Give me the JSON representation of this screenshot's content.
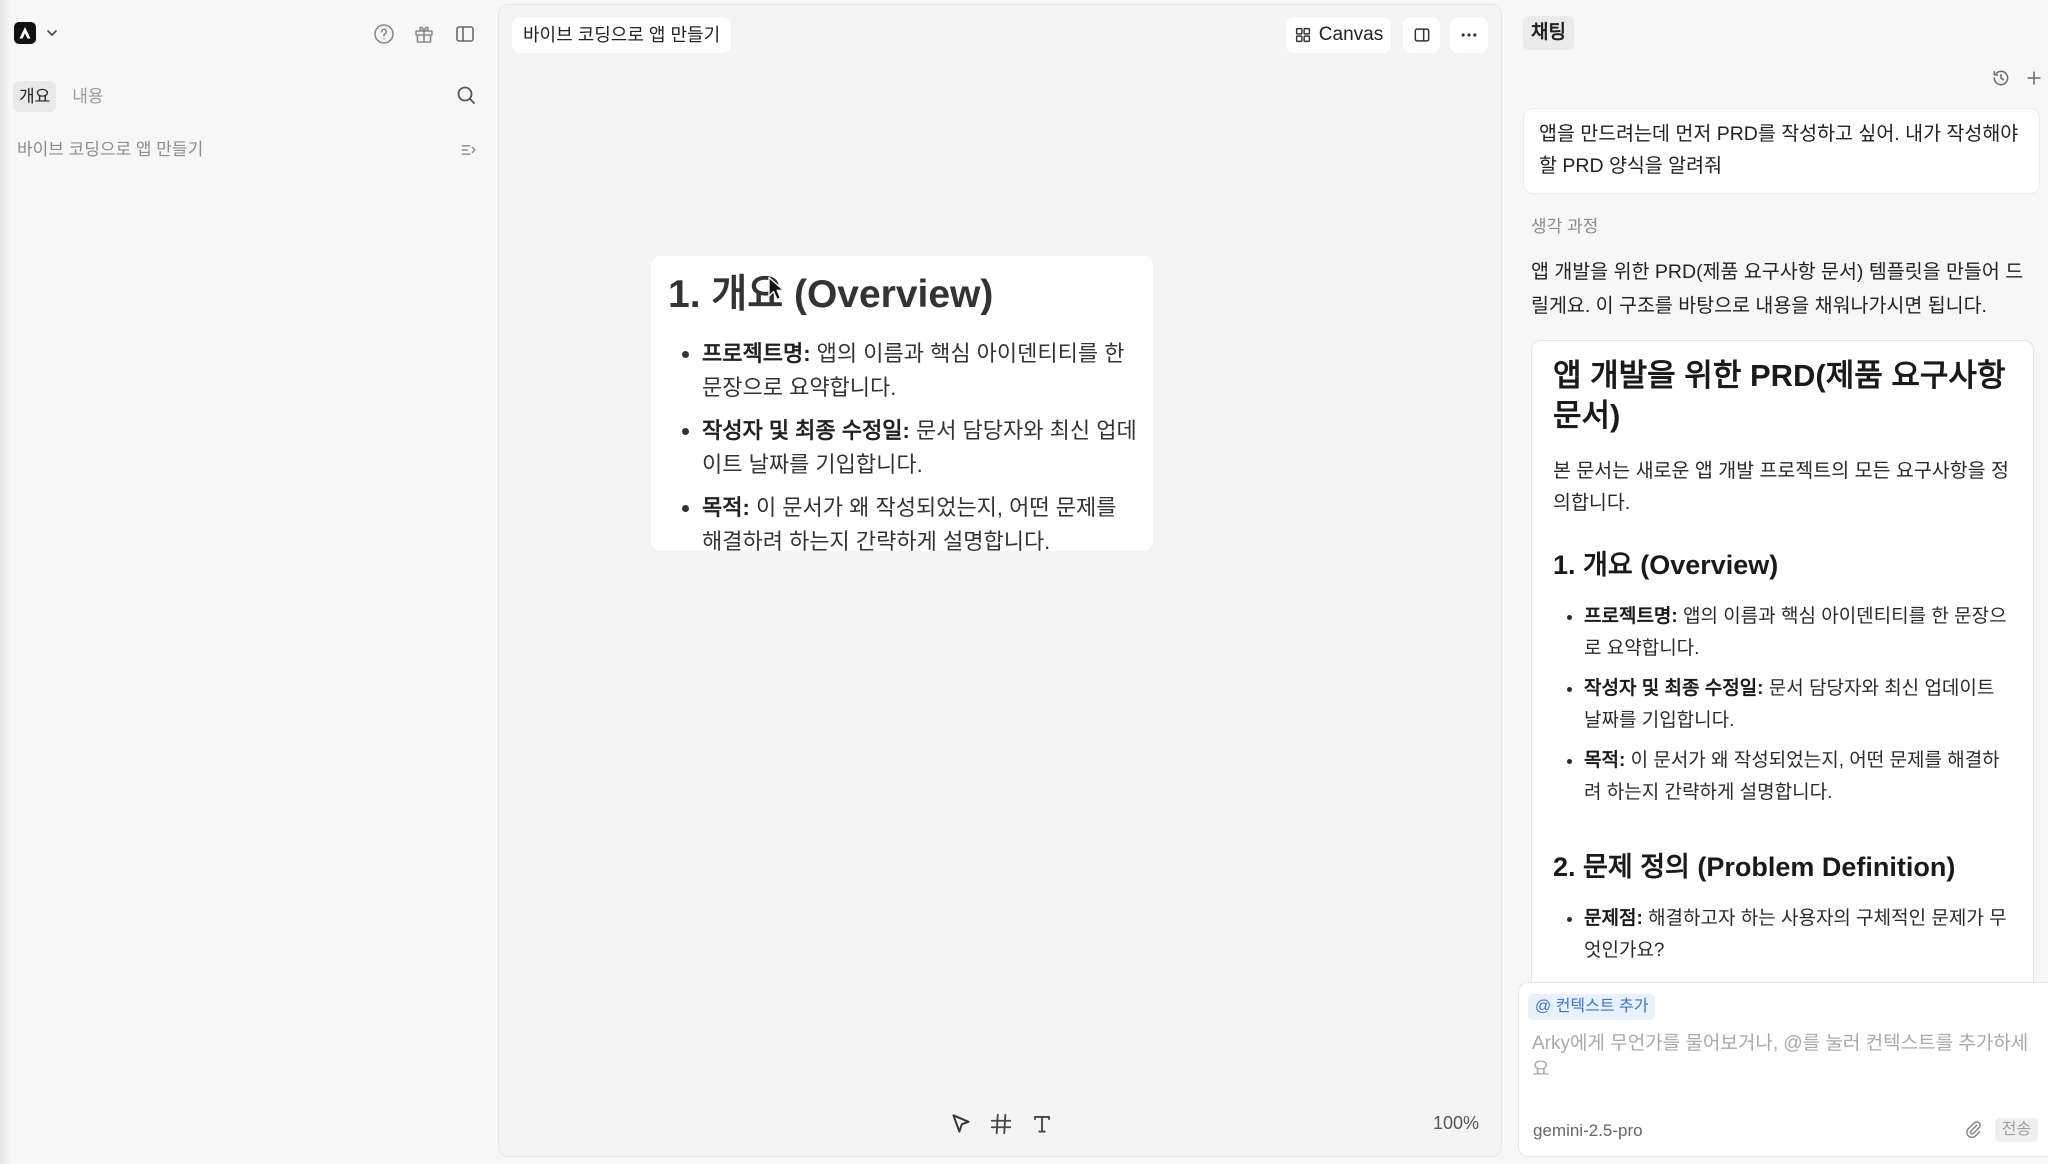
{
  "sidebar": {
    "tabs": [
      {
        "label": "개요",
        "active": true
      },
      {
        "label": "내용",
        "active": false
      }
    ],
    "items": [
      {
        "label": "바이브 코딩으로 앱 만들기"
      }
    ],
    "header_icons": [
      "app-logo-icon",
      "chevron-down-icon",
      "help-icon",
      "gift-icon",
      "sidebar-toggle-icon",
      "search-icon",
      "outline-icon"
    ]
  },
  "editor": {
    "tab_title": "바이브 코딩으로 앱 만들기",
    "canvas_label": "Canvas",
    "toolbar_icons": [
      "canvas-grid-icon",
      "split-view-icon",
      "more-icon"
    ],
    "card": {
      "heading": "1. 개요 (Overview)",
      "bullets": [
        {
          "label": "프로젝트명:",
          "text": "앱의 이름과 핵심 아이덴티티를 한 문장으로 요약합니다."
        },
        {
          "label": "작성자 및 최종 수정일:",
          "text": "문서 담당자와 최신 업데이트 날짜를 기입합니다."
        },
        {
          "label": "목적:",
          "text": "이 문서가 왜 작성되었는지, 어떤 문제를 해결하려 하는지 간략하게 설명합니다."
        }
      ]
    },
    "tools": [
      "select-pointer-icon",
      "frame-hash-icon",
      "text-tool-icon"
    ],
    "zoom": "100%"
  },
  "chat": {
    "tab_label": "채팅",
    "header_icons": [
      "history-icon",
      "plus-icon"
    ],
    "user_message": "앱을 만드려는데 먼저 PRD를 작성하고 싶어. 내가 작성해야 할 PRD 양식을 알려줘",
    "thinking_label": "생각 과정",
    "response_intro": "앱 개발을 위한 PRD(제품 요구사항 문서) 템플릿을 만들어 드릴게요. 이 구조를 바탕으로 내용을 채워나가시면 됩니다.",
    "document": {
      "title": "앱 개발을 위한 PRD(제품 요구사항 문서)",
      "intro": "본 문서는 새로운 앱 개발 프로젝트의 모든 요구사항을 정의합니다.",
      "sections": [
        {
          "heading": "1. 개요 (Overview)",
          "bullets": [
            {
              "label": "프로젝트명:",
              "text": "앱의 이름과 핵심 아이덴티티를 한 문장으로 요약합니다."
            },
            {
              "label": "작성자 및 최종 수정일:",
              "text": "문서 담당자와 최신 업데이트 날짜를 기입합니다."
            },
            {
              "label": "목적:",
              "text": "이 문서가 왜 작성되었는지, 어떤 문제를 해결하려 하는지 간략하게 설명합니다."
            }
          ]
        },
        {
          "heading": "2. 문제 정의 (Problem Definition)",
          "bullets": [
            {
              "label": "문제점:",
              "text": "해결하고자 하는 사용자의 구체적인 문제가 무엇인가요?"
            }
          ]
        }
      ]
    },
    "input": {
      "context_chip": "@ 컨텍스트 추가",
      "placeholder": "Arky에게 무언가를 물어보거나, @를 눌러 컨텍스트를 추가하세요",
      "model": "gemini-2.5-pro",
      "send_label": "전송",
      "attach_icon": "paperclip-icon"
    }
  },
  "colors": {
    "page-bg": "#f7f7f7",
    "panel-bg": "#f4f4f4",
    "chip-bg": "#e9f1fc",
    "chip-fg": "#3b73c9",
    "pill-bg": "#e9e9e9"
  }
}
